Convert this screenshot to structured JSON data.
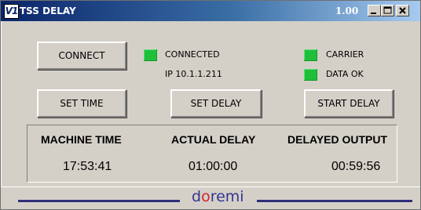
{
  "window": {
    "app_icon_text": "V1",
    "title": "TSS DELAY",
    "version": "1.00",
    "controls": [
      "minimize-icon",
      "maximize-icon",
      "close-icon"
    ]
  },
  "buttons": {
    "connect": "CONNECT",
    "set_time": "SET TIME",
    "set_delay": "SET DELAY",
    "start_delay": "START DELAY"
  },
  "status": {
    "connected_label": "CONNECTED",
    "ip_text": "IP 10.1.1.211",
    "carrier_label": "CARRIER",
    "data_ok_label": "DATA OK",
    "indicator_color": "#1fbf3a"
  },
  "readouts": {
    "machine_time": {
      "label": "MACHINE TIME",
      "value": "17:53:41"
    },
    "actual_delay": {
      "label": "ACTUAL DELAY",
      "value": "01:00:00"
    },
    "delayed_output": {
      "label": "DELAYED OUTPUT",
      "value": "00:59:56"
    }
  },
  "footer": {
    "logo_prefix": "d",
    "logo_accent": "o",
    "logo_suffix": "remi",
    "logo_color": "#343493",
    "logo_accent_color": "#d2232a"
  }
}
